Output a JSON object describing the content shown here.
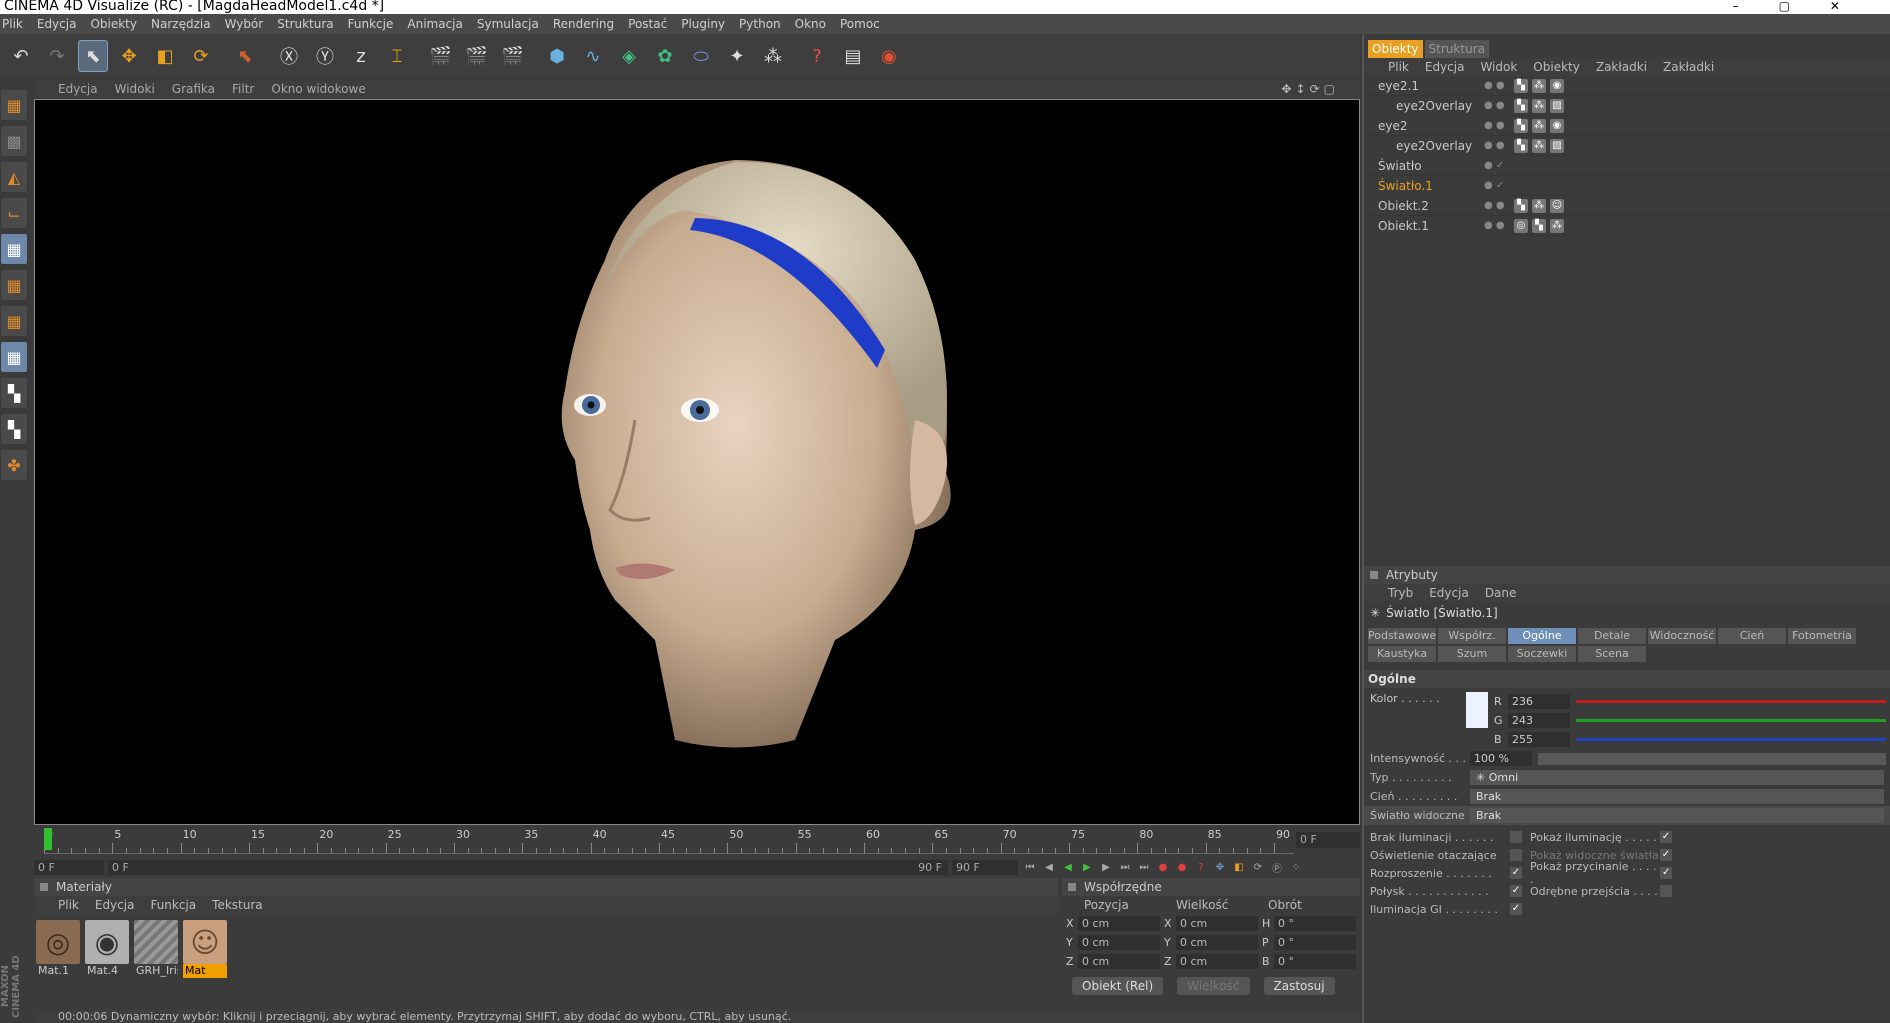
{
  "window": {
    "title": "CINEMA 4D Visualize (RC) - [MagdaHeadModel1.c4d *]"
  },
  "menubar": [
    "Plik",
    "Edycja",
    "Obiekty",
    "Narzędzia",
    "Wybór",
    "Struktura",
    "Funkcje",
    "Animacja",
    "Symulacja",
    "Rendering",
    "Postać",
    "Pluginy",
    "Python",
    "Okno",
    "Pomoc"
  ],
  "viewport": {
    "menu": [
      "Edycja",
      "Widoki",
      "Grafika",
      "Filtr",
      "Okno widokowe"
    ]
  },
  "timeline": {
    "ticks": [
      "0",
      "5",
      "10",
      "15",
      "20",
      "25",
      "30",
      "35",
      "40",
      "45",
      "50",
      "55",
      "60",
      "65",
      "70",
      "75",
      "80",
      "85",
      "90"
    ],
    "current": "0 F",
    "start": "0 F",
    "range_start": "0 F",
    "range_end": "90 F",
    "end": "90 F"
  },
  "materials": {
    "title": "Materiały",
    "menu": [
      "Plik",
      "Edycja",
      "Funkcja",
      "Tekstura"
    ],
    "items": [
      "Mat.1",
      "Mat.4",
      "GRH_Iris",
      "Mat"
    ]
  },
  "coords": {
    "title": "Współrzędne",
    "headers": [
      "Pozycja",
      "Wielkość",
      "Obrót"
    ],
    "rows": [
      {
        "a": "X",
        "pos": "0 cm",
        "b": "X",
        "size": "0 cm",
        "c": "H",
        "rot": "0 °"
      },
      {
        "a": "Y",
        "pos": "0 cm",
        "b": "Y",
        "size": "0 cm",
        "c": "P",
        "rot": "0 °"
      },
      {
        "a": "Z",
        "pos": "0 cm",
        "b": "Z",
        "size": "0 cm",
        "c": "B",
        "rot": "0 °"
      }
    ],
    "mode": "Obiekt (Rel)",
    "size_mode": "Wielkość",
    "apply": "Zastosuj"
  },
  "status": "00:00:06   Dynamiczny wybór: Kliknij i przeciągnij, aby wybrać elementy. Przytrzymaj SHIFT, aby dodać do wyboru, CTRL, aby usunąć.",
  "objects": {
    "tabs": [
      "Obiekty",
      "Struktura"
    ],
    "menu": [
      "Plik",
      "Edycja",
      "Widok",
      "Obiekty",
      "Zakładki",
      "Zakładki"
    ],
    "rows": [
      {
        "name": "eye2.1",
        "child": false,
        "sel": false
      },
      {
        "name": "eye2Overlay",
        "child": true,
        "sel": false
      },
      {
        "name": "eye2",
        "child": false,
        "sel": false
      },
      {
        "name": "eye2Overlay",
        "child": true,
        "sel": false
      },
      {
        "name": "Światło",
        "child": false,
        "sel": false
      },
      {
        "name": "Światło.1",
        "child": false,
        "sel": true
      },
      {
        "name": "Obiekt.2",
        "child": false,
        "sel": false
      },
      {
        "name": "Obiekt.1",
        "child": false,
        "sel": false
      }
    ]
  },
  "attributes": {
    "title": "Atrybuty",
    "menu": [
      "Tryb",
      "Edycja",
      "Dane"
    ],
    "object": "Światło [Światło.1]",
    "tabs": [
      "Podstawowe",
      "Współrz.",
      "Ogólne",
      "Detale",
      "Widoczność",
      "Cień",
      "Fotometria",
      "Kaustyka",
      "Szum",
      "Soczewki",
      "Scena"
    ],
    "active_tab": "Ogólne",
    "section": "Ogólne",
    "color_label": "Kolor . . . . . .",
    "r": "236",
    "g": "243",
    "b": "255",
    "intensity_label": "Intensywność . . .",
    "intensity": "100 %",
    "type_label": "Typ . . . . . . . . .",
    "type": "Omni",
    "shadow_label": "Cień . . . . . . . . .",
    "shadow": "Brak",
    "visible_label": "Światło widoczne",
    "visible": "Brak",
    "checks_left": [
      {
        "label": "Brak iluminacji . . . . . .",
        "on": false
      },
      {
        "label": "Oświetlenie otaczające",
        "on": false
      },
      {
        "label": "Rozproszenie . . . . . . .",
        "on": true
      },
      {
        "label": "Połysk . . . . . . . . . . . .",
        "on": true
      },
      {
        "label": "Iluminacja GI . . . . . . . .",
        "on": true
      }
    ],
    "checks_right": [
      {
        "label": "Pokaż iluminację . . . . .",
        "on": true,
        "dim": false
      },
      {
        "label": "Pokaż widoczne światła",
        "on": true,
        "dim": true
      },
      {
        "label": "Pokaż przycinanie . . . . .",
        "on": true,
        "dim": false
      },
      {
        "label": "Odrębne przejścia . . . .",
        "on": false,
        "dim": false
      }
    ]
  }
}
